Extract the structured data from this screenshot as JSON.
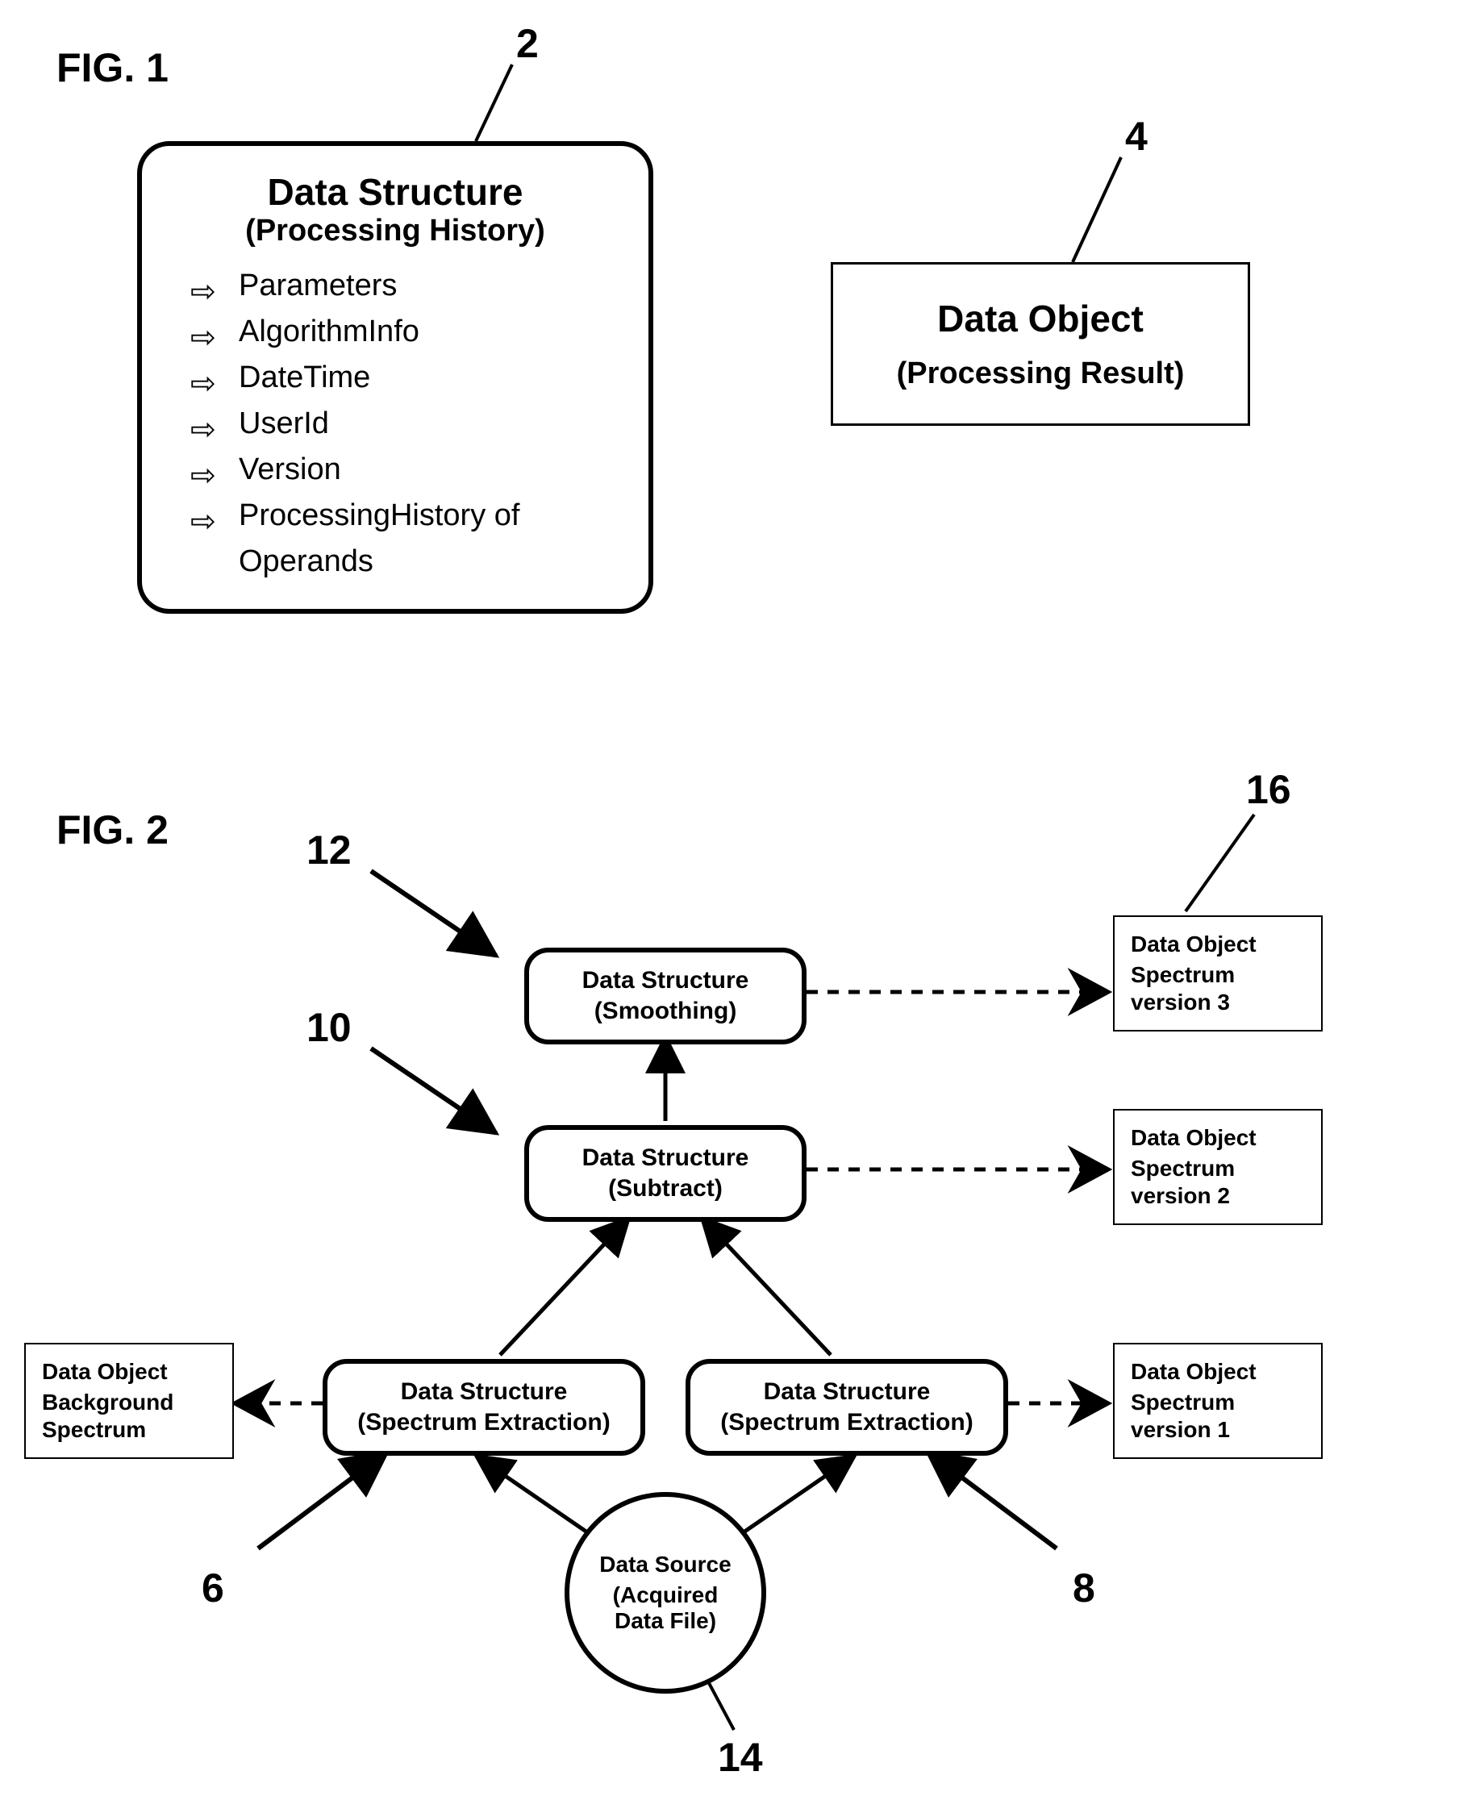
{
  "fig1": {
    "label": "FIG. 1",
    "ref2": "2",
    "ref4": "4",
    "data_structure": {
      "title": "Data Structure",
      "subtitle": "(Processing History)",
      "items": [
        "Parameters",
        "AlgorithmInfo",
        "DateTime",
        "UserId",
        "Version",
        "ProcessingHistory of Operands"
      ]
    },
    "data_object": {
      "title": "Data Object",
      "subtitle": "(Processing Result)"
    }
  },
  "fig2": {
    "label": "FIG. 2",
    "refs": {
      "r6": "6",
      "r8": "8",
      "r10": "10",
      "r12": "12",
      "r14": "14",
      "r16": "16"
    },
    "nodes": {
      "smoothing": {
        "l1": "Data Structure",
        "l2": "(Smoothing)"
      },
      "subtract": {
        "l1": "Data Structure",
        "l2": "(Subtract)"
      },
      "extract_left": {
        "l1": "Data Structure",
        "l2": "(Spectrum Extraction)"
      },
      "extract_right": {
        "l1": "Data Structure",
        "l2": "(Spectrum Extraction)"
      },
      "source": {
        "l1": "Data Source",
        "l2_a": "(Acquired",
        "l2_b": "Data File)"
      },
      "obj_bg": {
        "l1": "Data Object",
        "l2": "Background",
        "l3": "Spectrum"
      },
      "obj_v1": {
        "l1": "Data Object",
        "l2": "Spectrum",
        "l3": "version 1"
      },
      "obj_v2": {
        "l1": "Data Object",
        "l2": "Spectrum",
        "l3": "version 2"
      },
      "obj_v3": {
        "l1": "Data Object",
        "l2": "Spectrum",
        "l3": "version 3"
      }
    }
  }
}
